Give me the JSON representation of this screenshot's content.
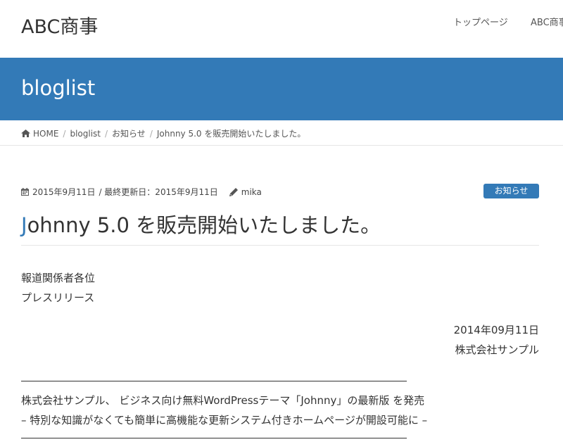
{
  "header": {
    "site_title": "ABC商事",
    "nav": [
      "トップページ",
      "ABC商事"
    ]
  },
  "banner": {
    "title": "bloglist"
  },
  "breadcrumb": {
    "home": "HOME",
    "items": [
      "bloglist",
      "お知らせ",
      "Johnny 5.0 を販売開始いたしました。"
    ]
  },
  "post": {
    "date": "2015年9月11日",
    "updated_label": "/ 最終更新日：2015年9月11日",
    "author": "mika",
    "category": "お知らせ",
    "title_first": "J",
    "title_rest": "ohnny 5.0 を販売開始いたしました。",
    "lines": {
      "recipients": "報道関係者各位",
      "type": "プレスリリース",
      "release_date": "2014年09月11日",
      "company": "株式会社サンプル",
      "headline": "株式会社サンプル、 ビジネス向け無料WordPressテーマ「Johnny」の最新版 を発売",
      "subheadline": "– 特別な知識がなくても簡単に高機能な更新システム付きホームページが開設可能に –"
    }
  },
  "colors": {
    "accent": "#337ab7",
    "text": "#333333"
  },
  "icons": {
    "home": "home-icon",
    "calendar": "calendar-icon",
    "author": "pencil-icon"
  }
}
